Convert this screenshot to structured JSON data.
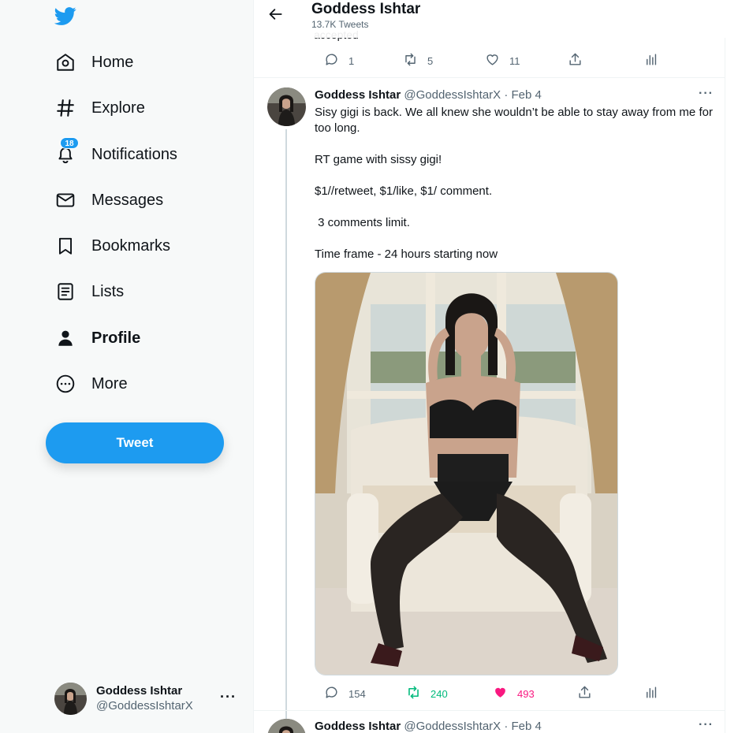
{
  "sidebar": {
    "nav": [
      {
        "label": "Home",
        "icon": "home-icon"
      },
      {
        "label": "Explore",
        "icon": "hashtag-icon"
      },
      {
        "label": "Notifications",
        "icon": "bell-icon",
        "badge": "18"
      },
      {
        "label": "Messages",
        "icon": "envelope-icon"
      },
      {
        "label": "Bookmarks",
        "icon": "bookmark-icon"
      },
      {
        "label": "Lists",
        "icon": "list-icon"
      },
      {
        "label": "Profile",
        "icon": "person-icon"
      },
      {
        "label": "More",
        "icon": "more-circle-icon"
      }
    ],
    "tweet_button": "Tweet",
    "account": {
      "name": "Goddess Ishtar",
      "handle": "@GoddessIshtarX",
      "more": "···"
    }
  },
  "header": {
    "title": "Goddess Ishtar",
    "subtitle": "13.7K Tweets"
  },
  "prev_tweet": {
    "tail_text": "accepted",
    "replies": "1",
    "retweets": "5",
    "likes": "11"
  },
  "tweet": {
    "name": "Goddess Ishtar",
    "meta": "@GoddessIshtarX · Feb 4",
    "more": "···",
    "body": [
      "Sisy gigi is back. We all knew she wouldn’t be able to stay away from me for too long.",
      "RT game with sissy gigi!",
      "$1//retweet, $1/like, $1/ comment.",
      " 3 comments limit.",
      "Time frame - 24 hours starting now"
    ],
    "replies": "154",
    "retweets": "240",
    "likes": "493",
    "retweet_color": "#00ba7c",
    "like_color": "#f91880"
  },
  "next_tweet": {
    "name": "Goddess Ishtar",
    "meta": "@GoddessIshtarX · Feb 4",
    "more": "···"
  },
  "colors": {
    "accent": "#1d9bf0",
    "sidebar_bg": "#f7f9f9",
    "muted": "#536471"
  }
}
